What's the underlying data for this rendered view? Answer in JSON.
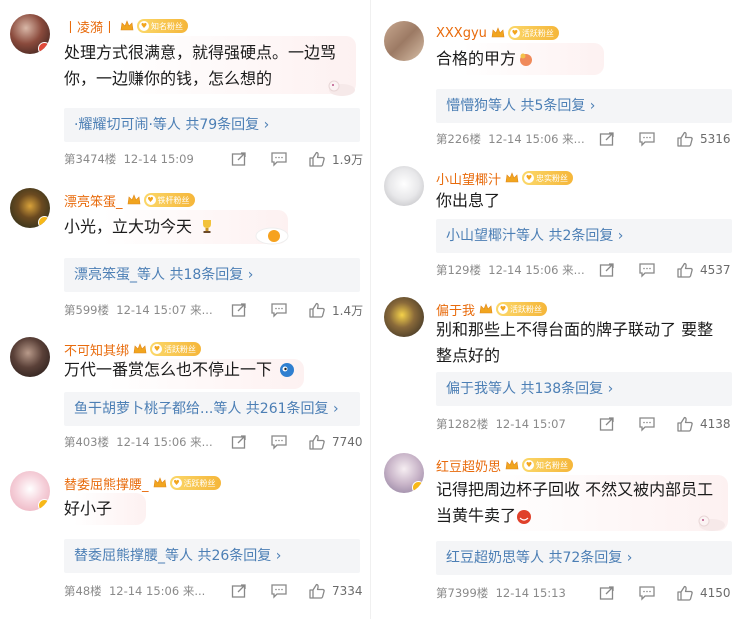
{
  "left_column": [
    {
      "user": "丨凌漪丨",
      "fan_badge": "知名粉丝",
      "text": "处理方式很满意，就得强硬点。一边骂你，一边赚你的钱，怎么想的",
      "replies_label": "·耀耀切可闹·等人  共79条回复 ›",
      "floor": "第3474楼",
      "time": "12-14 15:09",
      "likes": "1.9万"
    },
    {
      "user": "漂亮笨蛋_",
      "fan_badge": "铁杆粉丝",
      "text": "小光，立大功今天",
      "replies_label": "漂亮笨蛋_等人  共18条回复 ›",
      "floor": "第599楼",
      "time": "12-14 15:07",
      "extra": "来...",
      "likes": "1.4万"
    },
    {
      "user": "不可知其绑",
      "fan_badge": "活跃粉丝",
      "text": "万代一番赏怎么也不停止一下",
      "replies_label": "鱼干胡萝卜桃子都给...等人  共261条回复 ›",
      "floor": "第403楼",
      "time": "12-14 15:06",
      "extra": "来...",
      "likes": "7740"
    },
    {
      "user": "替委屈熊撑腰_",
      "fan_badge": "活跃粉丝",
      "text": "好小子",
      "replies_label": "替委屈熊撑腰_等人  共26条回复 ›",
      "floor": "第48楼",
      "time": "12-14 15:06",
      "extra": "来...",
      "likes": "7334"
    }
  ],
  "right_column": [
    {
      "user": "XXXgyu",
      "fan_badge": "活跃粉丝",
      "text": "合格的甲方",
      "replies_label": "懵懵狗等人  共5条回复 ›",
      "floor": "第226楼",
      "time": "12-14 15:06",
      "extra": "来...",
      "likes": "5316"
    },
    {
      "user": "小山望椰汁",
      "fan_badge": "忠实粉丝",
      "text": "你出息了",
      "replies_label": "小山望椰汁等人  共2条回复 ›",
      "floor": "第129楼",
      "time": "12-14 15:06",
      "extra": "来...",
      "likes": "4537"
    },
    {
      "user": "偏于我",
      "fan_badge": "活跃粉丝",
      "text": "别和那些上不得台面的牌子联动了 要整整点好的",
      "replies_label": "偏于我等人  共138条回复 ›",
      "floor": "第1282楼",
      "time": "12-14 15:07",
      "likes": "4138"
    },
    {
      "user": "红豆超奶思",
      "fan_badge": "知名粉丝",
      "text": "记得把周边杯子回收 不然又被内部员工当黄牛卖了",
      "replies_label": "红豆超奶思等人  共72条回复 ›",
      "floor": "第7399楼",
      "time": "12-14 15:13",
      "likes": "4150"
    }
  ],
  "icons": {
    "share": "share-icon",
    "comment": "comment-icon",
    "like": "thumbs-up-icon",
    "crown": "crown-icon",
    "fan_badge": "fan-badge-icon"
  },
  "colors": {
    "username": "#e86b0c",
    "reply_link": "#4c7fb5",
    "reply_bg": "#f4f5f7",
    "meta_gray": "#8a8a8a",
    "fan_badge": "#f5b63a"
  }
}
